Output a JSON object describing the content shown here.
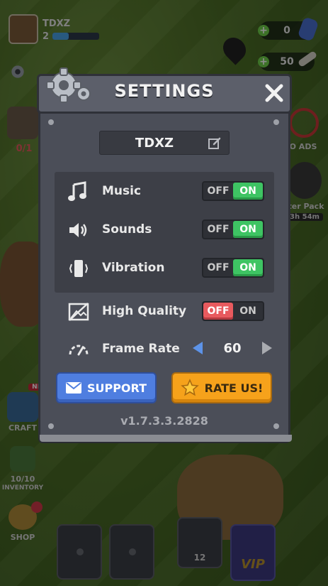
{
  "player": {
    "name": "TDXZ",
    "level": "2"
  },
  "resources": {
    "gems": "0",
    "bones": "50"
  },
  "hud_left": {
    "pickaxe_count": "0/1",
    "craft_label": "CRAFT",
    "craft_badge": "NE",
    "inventory_count": "10/10",
    "inventory_label": "INVENTORY",
    "shop_label": "SHOP"
  },
  "hud_right": {
    "no_ads_label": "O ADS",
    "starter_pack_label": "ter Pack",
    "starter_pack_timer": "3h 54m"
  },
  "bottom_bar": {
    "item_count": "12",
    "vip_label": "VIP"
  },
  "settings": {
    "title": "SETTINGS",
    "username": "TDXZ",
    "toggles": [
      {
        "label": "Music",
        "off_label": "OFF",
        "on_label": "ON",
        "state": "on",
        "icon": "music-note-icon"
      },
      {
        "label": "Sounds",
        "off_label": "OFF",
        "on_label": "ON",
        "state": "on",
        "icon": "speaker-icon"
      },
      {
        "label": "Vibration",
        "off_label": "OFF",
        "on_label": "ON",
        "state": "on",
        "icon": "vibration-icon"
      },
      {
        "label": "High Quality",
        "off_label": "OFF",
        "on_label": "ON",
        "state": "off",
        "icon": "image-quality-icon"
      }
    ],
    "frame_rate": {
      "label": "Frame Rate",
      "value": "60",
      "icon": "speedometer-icon"
    },
    "support_label": "SUPPORT",
    "rate_label": "RATE US!",
    "version": "v1.7.3.3.2828"
  },
  "colors": {
    "toggle_on": "#3ec463",
    "toggle_off": "#e85a5e",
    "support_button": "#4f7ee0",
    "rate_button": "#f6a21b",
    "panel": "#4b4e58"
  }
}
